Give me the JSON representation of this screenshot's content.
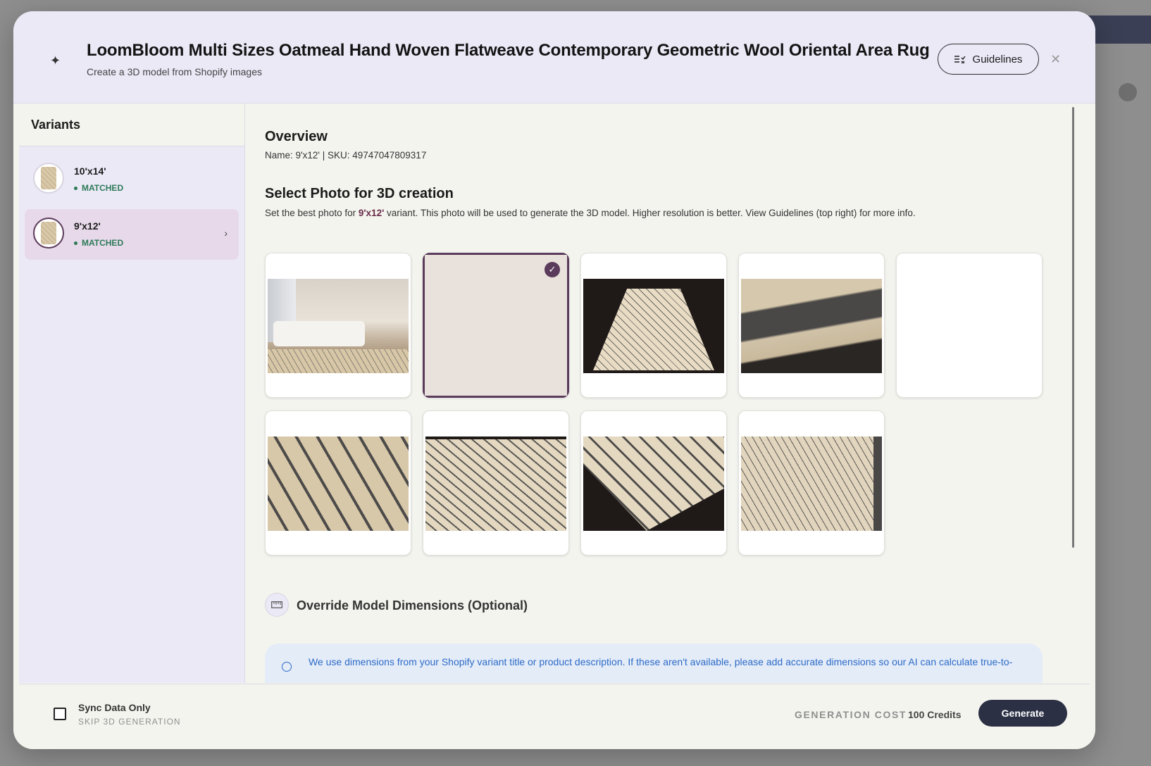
{
  "header": {
    "title": "LoomBloom Multi Sizes Oatmeal Hand Woven Flatweave Contemporary Geometric Wool Oriental Area Rug",
    "subtitle": "Create a 3D model from Shopify images",
    "guidelines_label": "Guidelines",
    "close_icon": "close-icon",
    "sparkle_icon": "sparkle-icon"
  },
  "sidebar": {
    "heading": "Variants",
    "items": [
      {
        "name": "10'x14'",
        "status": "MATCHED",
        "selected": false
      },
      {
        "name": "9'x12'",
        "status": "MATCHED",
        "selected": true
      }
    ]
  },
  "overview": {
    "heading": "Overview",
    "details": "Name: 9'x12' | SKU: 49747047809317"
  },
  "photo_select": {
    "heading": "Select Photo for 3D creation",
    "desc_prefix": "Set the best photo for ",
    "desc_variant": "9'x12'",
    "desc_suffix": " variant. This photo will be used to generate the 3D model. Higher resolution is better. View Guidelines (top right) for more info.",
    "selected_index": 1,
    "photos": [
      {
        "kind": "room-scene"
      },
      {
        "kind": "flat-rug"
      },
      {
        "kind": "perspective-rug"
      },
      {
        "kind": "edge-closeup"
      },
      {
        "kind": "fold-closeup"
      },
      {
        "kind": "pile-closeup"
      },
      {
        "kind": "pattern-angle"
      },
      {
        "kind": "corner-closeup"
      },
      {
        "kind": "pattern-tilt"
      }
    ]
  },
  "dimensions": {
    "heading": "Override Model Dimensions (Optional)",
    "info": "We use dimensions from your Shopify variant title or product description. If these aren't available, please add accurate dimensions so our AI can calculate true-to-"
  },
  "footer": {
    "sync_label": "Sync Data Only",
    "sync_sub": "SKIP 3D GENERATION",
    "cost_label": "GENERATION COST",
    "cost_value": "100 Credits",
    "generate_label": "Generate"
  },
  "colors": {
    "accent": "#5b3b5b",
    "header_bg": "#ece9f7",
    "matched": "#2d7a57",
    "info_text": "#2d6bc7",
    "button": "#2b3044"
  }
}
